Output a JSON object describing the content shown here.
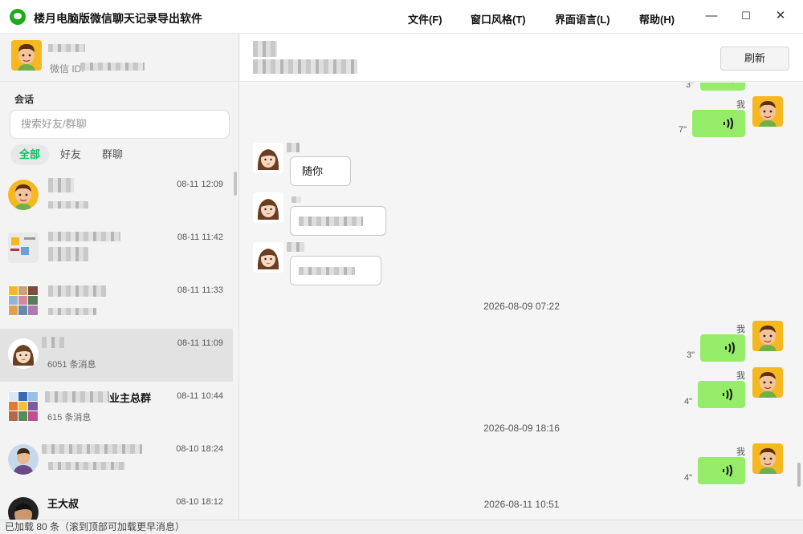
{
  "app": {
    "title": "楼月电脑版微信聊天记录导出软件"
  },
  "menu": {
    "file": "文件(F)",
    "style": "窗口风格(T)",
    "lang": "界面语言(L)",
    "help": "帮助(H)"
  },
  "window": {
    "minimize": "—",
    "maximize": "☐",
    "close": "✕"
  },
  "profile": {
    "wxid_label": "微信 ID:"
  },
  "sessions": {
    "title": "会话",
    "search_placeholder": "搜索好友/群聊",
    "filters": [
      "全部",
      "好友",
      "群聊"
    ],
    "items": [
      {
        "time": "08-11 12:09",
        "sub": ""
      },
      {
        "time": "08-11 11:42",
        "sub": ""
      },
      {
        "time": "08-11 11:33",
        "sub": ""
      },
      {
        "time": "08-11 11:09",
        "sub": "6051 条消息"
      },
      {
        "name": "业主总群",
        "time": "08-11 10:44",
        "sub": "615 条消息"
      },
      {
        "time": "08-10 18:24",
        "sub": ""
      },
      {
        "name": "王大叔",
        "time": "08-10 18:12",
        "sub": ""
      }
    ]
  },
  "chat": {
    "refresh_label": "刷新",
    "me_label": "我",
    "messages": [
      {
        "dur": "3\""
      },
      {
        "dur": "7\""
      },
      {
        "text": "随你"
      },
      {
        "time": "2026-08-09 07:22"
      },
      {
        "dur": "3\""
      },
      {
        "dur": "4\""
      },
      {
        "time": "2026-08-09 18:16"
      },
      {
        "dur": "4\""
      },
      {
        "time": "2026-08-11 10:51"
      }
    ]
  },
  "status": {
    "text": "已加载 80 条（滚到顶部可加载更早消息）"
  }
}
